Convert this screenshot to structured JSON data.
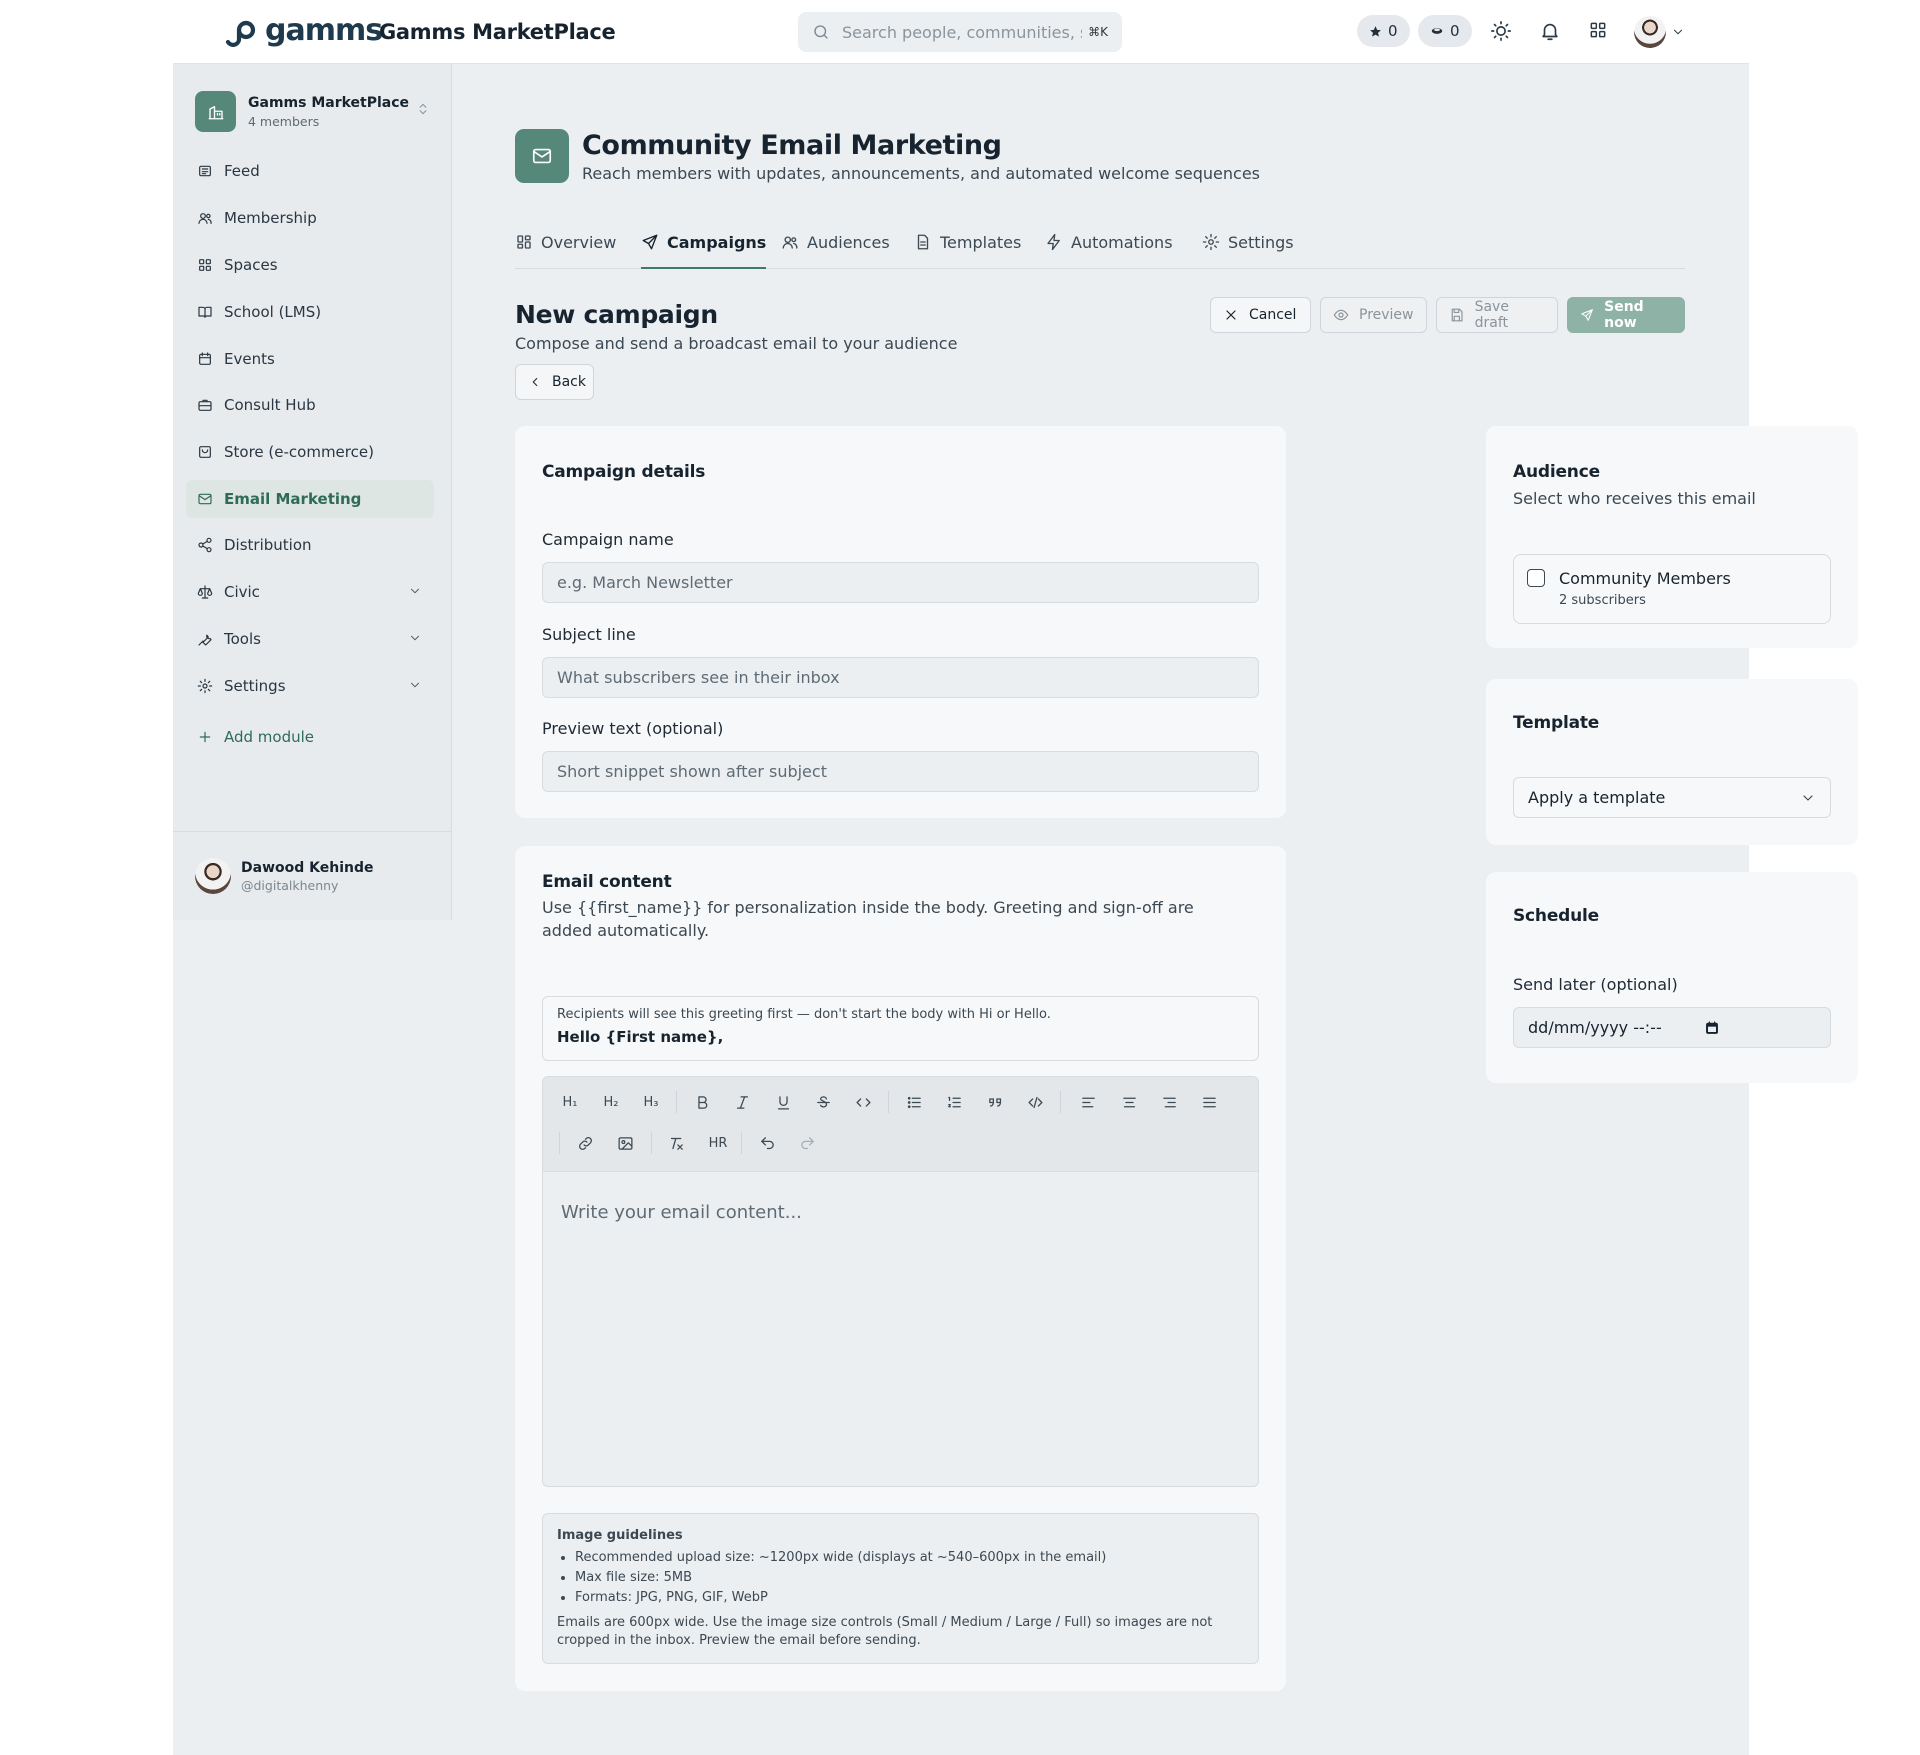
{
  "topbar": {
    "logo_text": "gamms",
    "brand": "Gamms MarketPlace",
    "search_placeholder": "Search people, communities, spaces",
    "search_shortcut": "⌘K",
    "stars_count": "0",
    "coins_count": "0"
  },
  "workspace": {
    "name": "Gamms MarketPlace",
    "members": "4 members"
  },
  "sidebar": {
    "items": [
      {
        "label": "Feed",
        "icon": "feed-icon"
      },
      {
        "label": "Membership",
        "icon": "users-icon"
      },
      {
        "label": "Spaces",
        "icon": "grid-icon"
      },
      {
        "label": "School (LMS)",
        "icon": "book-icon"
      },
      {
        "label": "Events",
        "icon": "calendar-icon"
      },
      {
        "label": "Consult Hub",
        "icon": "briefcase-icon"
      },
      {
        "label": "Store (e-commerce)",
        "icon": "store-icon"
      },
      {
        "label": "Email Marketing",
        "icon": "mail-icon",
        "active": true
      },
      {
        "label": "Distribution",
        "icon": "share-icon"
      },
      {
        "label": "Civic",
        "icon": "scale-icon",
        "expandable": true
      },
      {
        "label": "Tools",
        "icon": "wrench-icon",
        "expandable": true
      },
      {
        "label": "Settings",
        "icon": "gear-icon",
        "expandable": true
      }
    ],
    "add_module": "Add module"
  },
  "user": {
    "name": "Dawood Kehinde",
    "handle": "@digitalkhenny"
  },
  "page": {
    "title": "Community Email Marketing",
    "subtitle": "Reach members with updates, announcements, and automated welcome sequences"
  },
  "tabs": [
    {
      "label": "Overview"
    },
    {
      "label": "Campaigns",
      "active": true
    },
    {
      "label": "Audiences"
    },
    {
      "label": "Templates"
    },
    {
      "label": "Automations"
    },
    {
      "label": "Settings"
    }
  ],
  "campaign": {
    "title": "New campaign",
    "subtitle": "Compose and send a broadcast email to your audience",
    "cancel": "Cancel",
    "preview": "Preview",
    "save_draft": "Save draft",
    "send_now": "Send now",
    "back": "Back"
  },
  "details": {
    "title": "Campaign details",
    "name_label": "Campaign name",
    "name_placeholder": "e.g. March Newsletter",
    "subject_label": "Subject line",
    "subject_placeholder": "What subscribers see in their inbox",
    "preview_label": "Preview text (optional)",
    "preview_placeholder": "Short snippet shown after subject"
  },
  "content": {
    "title": "Email content",
    "description": "Use {{first_name}} for personalization inside the body. Greeting and sign-off are added automatically.",
    "greeting_note": "Recipients will see this greeting first — don't start the body with Hi or Hello.",
    "greeting": "Hello {First name},",
    "editor_placeholder": "Write your email content...",
    "toolbar": {
      "h1": "H₁",
      "h2": "H₂",
      "h3": "H₃",
      "hr": "HR"
    },
    "guidelines_title": "Image guidelines",
    "guidelines": [
      "Recommended upload size: ~1200px wide (displays at ~540–600px in the email)",
      "Max file size: 5MB",
      "Formats: JPG, PNG, GIF, WebP"
    ],
    "guidelines_footer": "Emails are 600px wide. Use the image size controls (Small / Medium / Large / Full) so images are not cropped in the inbox. Preview the email before sending."
  },
  "audience": {
    "title": "Audience",
    "subtitle": "Select who receives this email",
    "option_name": "Community Members",
    "option_sub": "2 subscribers"
  },
  "template": {
    "title": "Template",
    "select_value": "Apply a template"
  },
  "schedule": {
    "title": "Schedule",
    "label": "Send later (optional)",
    "date_placeholder": "dd/mm/yyyy --:--"
  },
  "colors": {
    "accent": "#56887a",
    "active_tab": "#3f7a67",
    "send_button": "#8fb2a6",
    "background": "#eceff2"
  }
}
